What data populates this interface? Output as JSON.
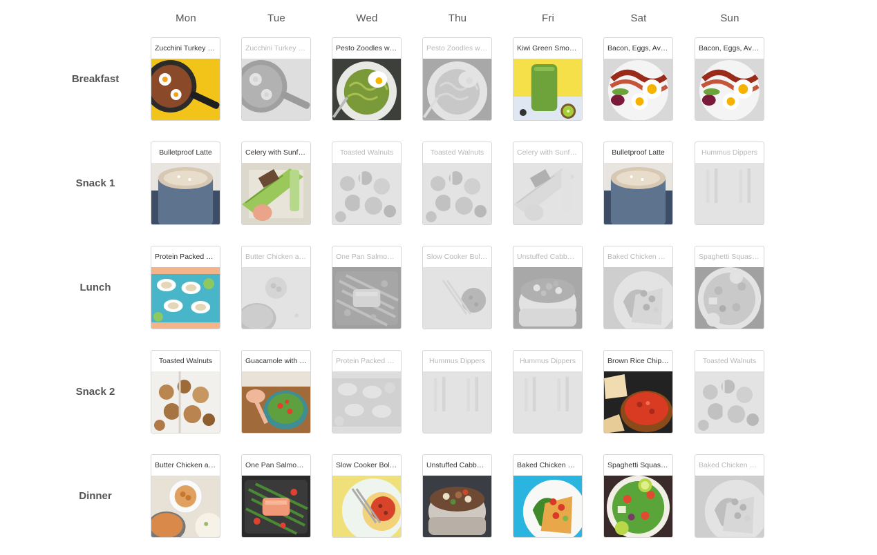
{
  "days": [
    "Mon",
    "Tue",
    "Wed",
    "Thu",
    "Fri",
    "Sat",
    "Sun"
  ],
  "meals": [
    "Breakfast",
    "Snack 1",
    "Lunch",
    "Snack 2",
    "Dinner"
  ],
  "grid": [
    [
      {
        "title": "Zucchini Turkey B...",
        "faded": false,
        "scene": "skillet"
      },
      {
        "title": "Zucchini Turkey B...",
        "faded": true,
        "scene": "skillet"
      },
      {
        "title": "Pesto Zoodles wit...",
        "faded": false,
        "scene": "zoodles"
      },
      {
        "title": "Pesto Zoodles wit...",
        "faded": true,
        "scene": "zoodles"
      },
      {
        "title": "Kiwi Green Smoot...",
        "faded": false,
        "scene": "smoothie"
      },
      {
        "title": "Bacon, Eggs, Avoc...",
        "faded": false,
        "scene": "bacon"
      },
      {
        "title": "Bacon, Eggs, Avoc...",
        "faded": false,
        "scene": "bacon"
      }
    ],
    [
      {
        "title": "Bulletproof Latte",
        "faded": false,
        "scene": "latte"
      },
      {
        "title": "Celery with Sunflo...",
        "faded": false,
        "scene": "celery"
      },
      {
        "title": "Toasted Walnuts",
        "faded": true,
        "scene": "walnuts"
      },
      {
        "title": "Toasted Walnuts",
        "faded": true,
        "scene": "walnuts"
      },
      {
        "title": "Celery with Sunflo...",
        "faded": true,
        "scene": "celery"
      },
      {
        "title": "Bulletproof Latte",
        "faded": false,
        "scene": "latte"
      },
      {
        "title": "Hummus Dippers",
        "faded": true,
        "scene": "hummus"
      }
    ],
    [
      {
        "title": "Protein Packed De...",
        "faded": false,
        "scene": "deviled"
      },
      {
        "title": "Butter Chicken an...",
        "faded": true,
        "scene": "butterchicken"
      },
      {
        "title": "One Pan Salmon ...",
        "faded": true,
        "scene": "salmon"
      },
      {
        "title": "Slow Cooker Bolo...",
        "faded": true,
        "scene": "bolognese"
      },
      {
        "title": "Unstuffed Cabbag...",
        "faded": true,
        "scene": "cabbage"
      },
      {
        "title": "Baked Chicken wi...",
        "faded": true,
        "scene": "bakedchicken"
      },
      {
        "title": "Spaghetti Squash...",
        "faded": true,
        "scene": "squash"
      }
    ],
    [
      {
        "title": "Toasted Walnuts",
        "faded": false,
        "scene": "walnuts"
      },
      {
        "title": "Guacamole with B...",
        "faded": false,
        "scene": "guac"
      },
      {
        "title": "Protein Packed De...",
        "faded": true,
        "scene": "deviled"
      },
      {
        "title": "Hummus Dippers",
        "faded": true,
        "scene": "hummus"
      },
      {
        "title": "Hummus Dippers",
        "faded": true,
        "scene": "hummus"
      },
      {
        "title": "Brown Rice Chips ...",
        "faded": false,
        "scene": "salsa"
      },
      {
        "title": "Toasted Walnuts",
        "faded": true,
        "scene": "walnuts"
      }
    ],
    [
      {
        "title": "Butter Chicken an...",
        "faded": false,
        "scene": "butterchicken"
      },
      {
        "title": "One Pan Salmon ...",
        "faded": false,
        "scene": "salmon"
      },
      {
        "title": "Slow Cooker Bolo...",
        "faded": false,
        "scene": "bolognese"
      },
      {
        "title": "Unstuffed Cabbag...",
        "faded": false,
        "scene": "cabbage"
      },
      {
        "title": "Baked Chicken wi...",
        "faded": false,
        "scene": "bakedchicken"
      },
      {
        "title": "Spaghetti Squash...",
        "faded": false,
        "scene": "squash"
      },
      {
        "title": "Baked Chicken wi...",
        "faded": true,
        "scene": "bakedchicken"
      }
    ]
  ]
}
